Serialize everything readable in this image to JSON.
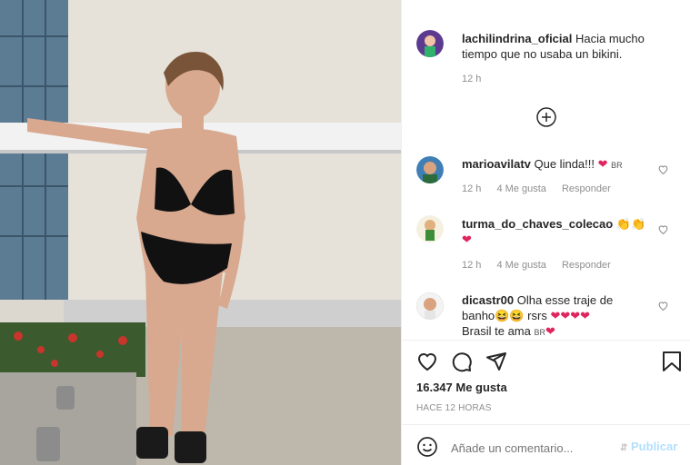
{
  "post": {
    "author": "lachilindrina_oficial",
    "caption": "Hacia mucho tiempo que no usaba un bikini.",
    "time": "12 h"
  },
  "comments": [
    {
      "user": "marioavilatv",
      "text": "Que linda!!!",
      "time": "12 h",
      "likes": "4 Me gusta",
      "reply": "Responder"
    },
    {
      "user": "turma_do_chaves_colecao",
      "text": "",
      "time": "12 h",
      "likes": "4 Me gusta",
      "reply": "Responder"
    },
    {
      "user": "dicastr00",
      "text_1": "Olha esse traje de",
      "text_2": "banho",
      "text_3": "rsrs",
      "text_4": "Brasil te ama"
    }
  ],
  "flag_label": "BR",
  "likes_count": "16.347 Me gusta",
  "timestamp": "HACE 12 HORAS",
  "comment_input": {
    "placeholder": "Añade un comentario...",
    "publish": "Publicar"
  },
  "colors": {
    "heart": "#e0245e",
    "muted": "#8e8e8e",
    "publish": "#b2dffc"
  }
}
